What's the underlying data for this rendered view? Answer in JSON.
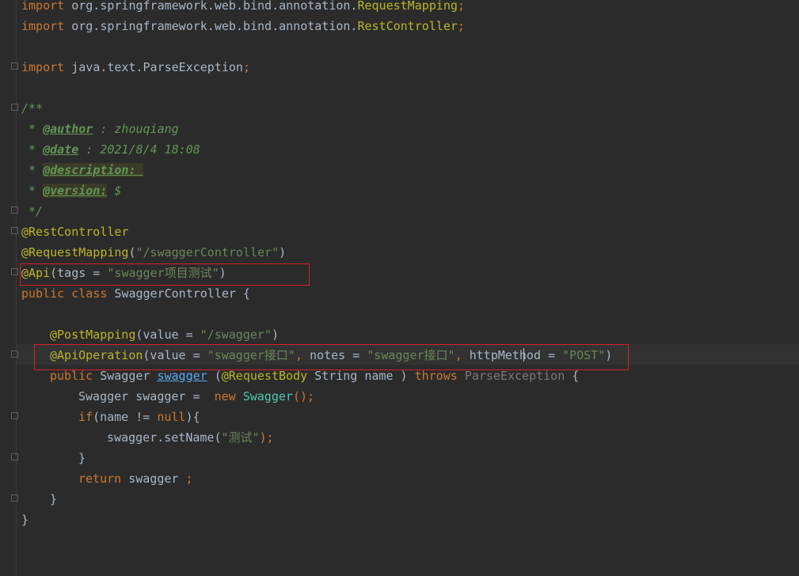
{
  "code": {
    "l1_import_kw": "import",
    "l1_path": " org.springframework.web.bind.annotation.",
    "l1_cls": "RequestMapping",
    "l1_semi": ";",
    "l2_import_kw": "import",
    "l2_path": " org.springframework.web.bind.annotation.",
    "l2_cls": "RestController",
    "l2_semi": ";",
    "l4_import_kw": "import",
    "l4_path": " java.text.ParseException",
    "l4_semi": ";",
    "l6_doc_open": "/**",
    "l7_star": " * ",
    "l7_tag": "@author",
    "l7_val": " : zhouqiang",
    "l8_star": " * ",
    "l8_tag": "@date",
    "l8_val": " : 2021/8/4 18:08",
    "l9_star": " * ",
    "l9_tag": "@description: ",
    "l10_star": " * ",
    "l10_tag": "@version:",
    "l10_val": " $",
    "l11_doc_close": " */",
    "l12_ann": "@RestController",
    "l13_ann": "@RequestMapping",
    "l13_open": "(",
    "l13_str": "\"/swaggerController\"",
    "l13_close": ")",
    "l14_ann": "@Api",
    "l14_open": "(tags = ",
    "l14_str": "\"swagger项目测试\"",
    "l14_close": ")",
    "l15_kw": "public class",
    "l15_rest": " SwaggerController {",
    "l17_ann": "@PostMapping",
    "l17_open": "(value = ",
    "l17_str": "\"/swagger\"",
    "l17_close": ")",
    "l18_ann": "@ApiOperation",
    "l18_a": "(value = ",
    "l18_s1": "\"swagger接口\"",
    "l18_comma1": ", ",
    "l18_b": "notes = ",
    "l18_s2": "\"swagger接口\"",
    "l18_comma2": ", ",
    "l18_c": "httpMethod = ",
    "l18_s3": "\"POST\"",
    "l18_close": ")",
    "l19_kw": "public",
    "l19_type": " Swagger ",
    "l19_method": "swagger",
    "l19_open": " (",
    "l19_ann": "@RequestBody",
    "l19_params": " String name ) ",
    "l19_throws": "throws",
    "l19_exc": " ParseException",
    "l19_brace": " {",
    "l20_decl": "Swagger swagger = ",
    "l20_new": " new",
    "l20_cls": " Swagger",
    "l20_end": "();",
    "l21_if": "if",
    "l21_cond": "(name != ",
    "l21_null": "null",
    "l21_end": "){",
    "l22_call": "swagger.setName(",
    "l22_str": "\"测试\"",
    "l22_end": ");",
    "l23_brace": "}",
    "l24_return": "return",
    "l24_rest": " swagger ",
    "l24_semi": ";",
    "l25_brace": "}",
    "l26_brace": "}"
  },
  "colors": {
    "background": "#2b2b2b",
    "keyword": "#cc7832",
    "annotation": "#bbb529",
    "string": "#6a8759",
    "highlight_box": "#d8202a"
  }
}
